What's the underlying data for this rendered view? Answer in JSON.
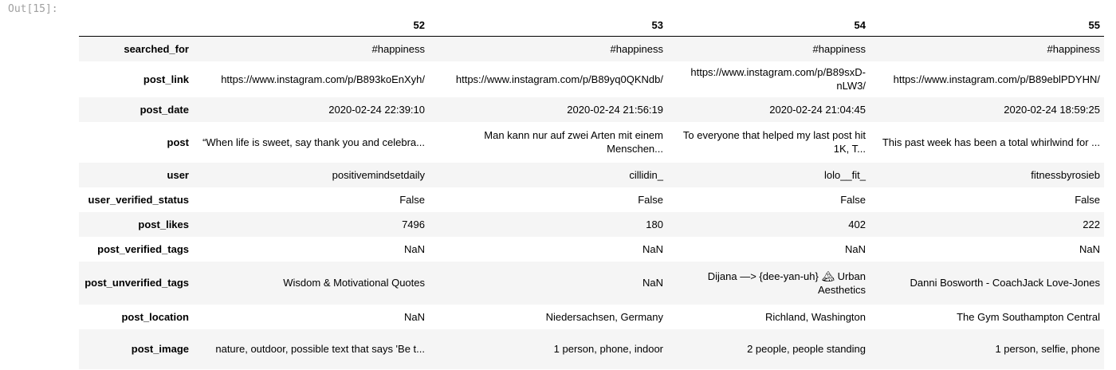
{
  "cell_prompt": "Out[15]:",
  "columns": [
    "52",
    "53",
    "54",
    "55"
  ],
  "rows": [
    {
      "label": "searched_for",
      "values": [
        "#happiness",
        "#happiness",
        "#happiness",
        "#happiness"
      ]
    },
    {
      "label": "post_link",
      "values": [
        "https://www.instagram.com/p/B893koEnXyh/",
        "https://www.instagram.com/p/B89yq0QKNdb/",
        "https://www.instagram.com/p/B89sxD-nLW3/",
        "https://www.instagram.com/p/B89eblPDYHN/"
      ]
    },
    {
      "label": "post_date",
      "values": [
        "2020-02-24 22:39:10",
        "2020-02-24 21:56:19",
        "2020-02-24 21:04:45",
        "2020-02-24 18:59:25"
      ]
    },
    {
      "label": "post",
      "values": [
        "“When life is sweet, say thank you and celebra...",
        "Man kann nur auf zwei Arten mit einem Menschen...",
        "To everyone that helped my last post hit 1K, T...",
        "This past week has been a total whirlwind for ..."
      ]
    },
    {
      "label": "user",
      "values": [
        "positivemindsetdaily",
        "cillidin_",
        "lolo__fit_",
        "fitnessbyrosieb"
      ]
    },
    {
      "label": "user_verified_status",
      "values": [
        "False",
        "False",
        "False",
        "False"
      ]
    },
    {
      "label": "post_likes",
      "values": [
        "7496",
        "180",
        "402",
        "222"
      ]
    },
    {
      "label": "post_verified_tags",
      "values": [
        "NaN",
        "NaN",
        "NaN",
        "NaN"
      ]
    },
    {
      "label": "post_unverified_tags",
      "values": [
        "Wisdom & Motivational Quotes",
        "NaN",
        "Dijana —> {dee-yan-uh} 🏔 Urban Aesthetics",
        "Danni Bosworth - CoachJack Love-Jones"
      ]
    },
    {
      "label": "post_location",
      "values": [
        "NaN",
        "Niedersachsen, Germany",
        "Richland, Washington",
        "The Gym Southampton Central"
      ]
    },
    {
      "label": "post_image",
      "values": [
        "nature, outdoor, possible text that says 'Be t...",
        "1 person, phone, indoor",
        "2 people, people standing",
        "1 person, selfie, phone"
      ]
    }
  ]
}
